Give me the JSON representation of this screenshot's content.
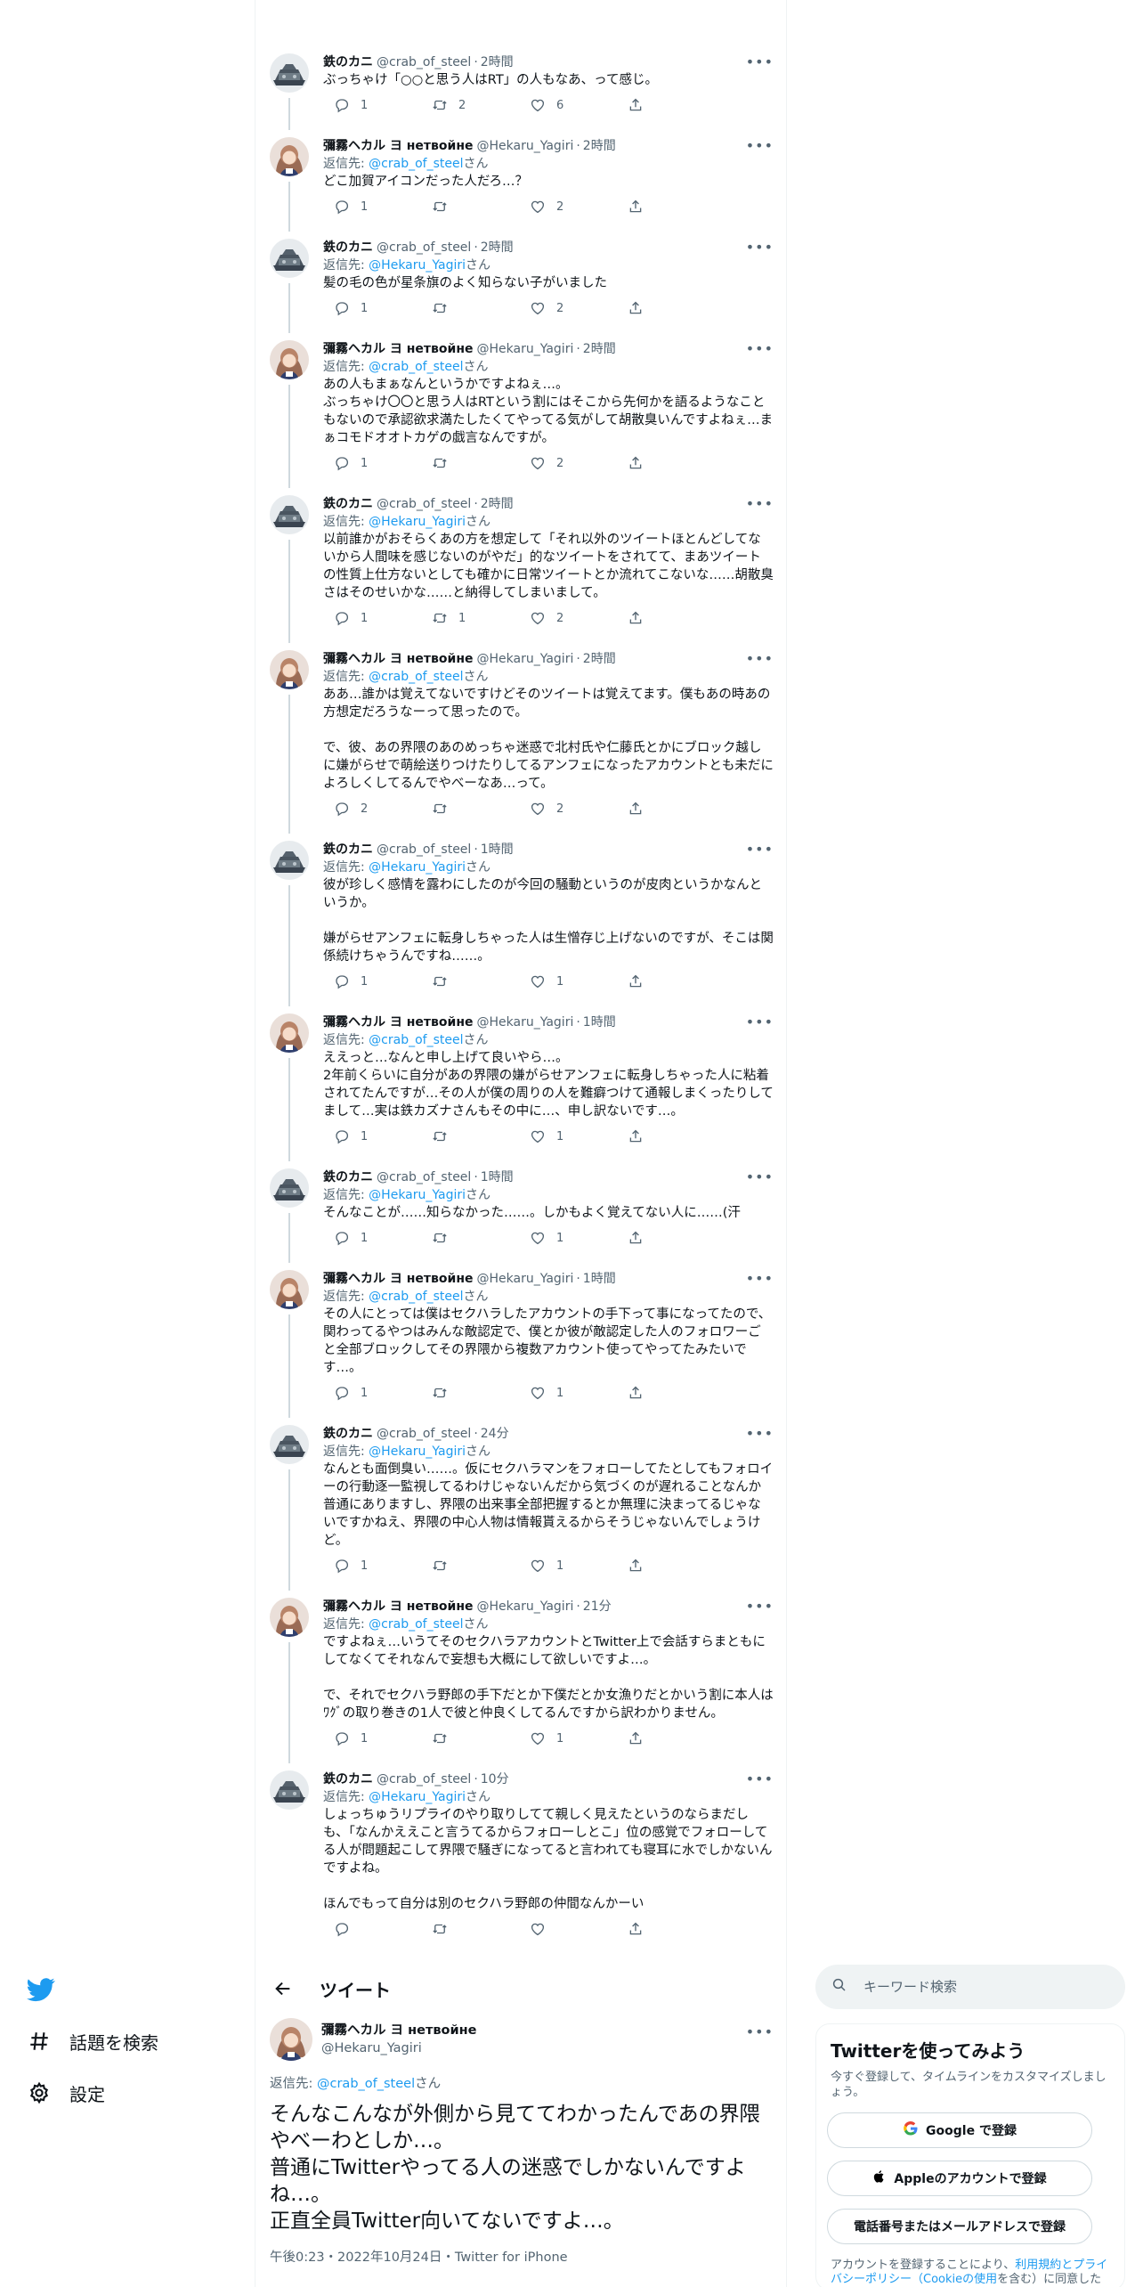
{
  "nav": {
    "explore_label": "話題を検索",
    "settings_label": "設定"
  },
  "colors": {
    "accent": "#1d9bf0",
    "muted": "#536471",
    "text": "#0f1419",
    "border": "#eff3f4"
  },
  "reply_prefix": "返信先: ",
  "reply_suffix": "さん",
  "tweets": [
    {
      "author": "crab",
      "name": "鉄のカニ",
      "handle": "@crab_of_steel",
      "time": "2時間",
      "reply_to": "",
      "text": "ぶっちゃけ「○○と思う人はRT」の人もなあ、って感じ。",
      "replies": "1",
      "retweets": "2",
      "likes": "6"
    },
    {
      "author": "hekaru",
      "name": "彌霧ヘカル ヨ нетвойне",
      "handle": "@Hekaru_Yagiri",
      "time": "2時間",
      "reply_to": "@crab_of_steel",
      "text": "どこ加賀アイコンだった人だろ…？",
      "replies": "1",
      "retweets": "",
      "likes": "2"
    },
    {
      "author": "crab",
      "name": "鉄のカニ",
      "handle": "@crab_of_steel",
      "time": "2時間",
      "reply_to": "@Hekaru_Yagiri",
      "text": "髪の毛の色が星条旗のよく知らない子がいました",
      "replies": "1",
      "retweets": "",
      "likes": "2"
    },
    {
      "author": "hekaru",
      "name": "彌霧ヘカル ヨ нетвойне",
      "handle": "@Hekaru_Yagiri",
      "time": "2時間",
      "reply_to": "@crab_of_steel",
      "text": "あの人もまぁなんというかですよねぇ…。\nぶっちゃけ〇〇と思う人はRTという割にはそこから先何かを語るようなこともないので承認欲求満たしたくてやってる気がして胡散臭いんですよねぇ…まぁコモドオオトカゲの戯言なんですが。",
      "replies": "1",
      "retweets": "",
      "likes": "2"
    },
    {
      "author": "crab",
      "name": "鉄のカニ",
      "handle": "@crab_of_steel",
      "time": "2時間",
      "reply_to": "@Hekaru_Yagiri",
      "text": "以前誰かがおそらくあの方を想定して「それ以外のツイートほとんどしてないから人間味を感じないのがやだ」的なツイートをされてて、まあツイートの性質上仕方ないとしても確かに日常ツイートとか流れてこないな……胡散臭さはそのせいかな……と納得してしまいまして。",
      "replies": "1",
      "retweets": "1",
      "likes": "2"
    },
    {
      "author": "hekaru",
      "name": "彌霧ヘカル ヨ нетвойне",
      "handle": "@Hekaru_Yagiri",
      "time": "2時間",
      "reply_to": "@crab_of_steel",
      "text": "ああ…誰かは覚えてないですけどそのツイートは覚えてます。僕もあの時あの方想定だろうなーって思ったので。\n\nで、彼、あの界隈のあのめっちゃ迷惑で北村氏や仁藤氏とかにブロック越しに嫌がらせで萌絵送りつけたりしてるアンフェになったアカウントとも未だによろしくしてるんでやべーなあ…って。",
      "replies": "2",
      "retweets": "",
      "likes": "2"
    },
    {
      "author": "crab",
      "name": "鉄のカニ",
      "handle": "@crab_of_steel",
      "time": "1時間",
      "reply_to": "@Hekaru_Yagiri",
      "text": "彼が珍しく感情を露わにしたのが今回の騒動というのが皮肉というかなんというか。\n\n嫌がらせアンフェに転身しちゃった人は生憎存じ上げないのですが、そこは関係続けちゃうんですね……。",
      "replies": "1",
      "retweets": "",
      "likes": "1"
    },
    {
      "author": "hekaru",
      "name": "彌霧ヘカル ヨ нетвойне",
      "handle": "@Hekaru_Yagiri",
      "time": "1時間",
      "reply_to": "@crab_of_steel",
      "text": "ええっと…なんと申し上げて良いやら…。\n2年前くらいに自分があの界隈の嫌がらせアンフェに転身しちゃった人に粘着されてたんですが…その人が僕の周りの人を難癖つけて通報しまくったりしてまして…実は鉄カズナさんもその中に…、申し訳ないです…。",
      "replies": "1",
      "retweets": "",
      "likes": "1"
    },
    {
      "author": "crab",
      "name": "鉄のカニ",
      "handle": "@crab_of_steel",
      "time": "1時間",
      "reply_to": "@Hekaru_Yagiri",
      "text": "そんなことが……知らなかった……。しかもよく覚えてない人に……(汗",
      "replies": "1",
      "retweets": "",
      "likes": "1"
    },
    {
      "author": "hekaru",
      "name": "彌霧ヘカル ヨ нетвойне",
      "handle": "@Hekaru_Yagiri",
      "time": "1時間",
      "reply_to": "@crab_of_steel",
      "text": "その人にとっては僕はセクハラしたアカウントの手下って事になってたので、関わってるやつはみんな敵認定で、僕とか彼が敵認定した人のフォロワーごと全部ブロックしてその界隈から複数アカウント使ってやってたみたいです…。",
      "replies": "1",
      "retweets": "",
      "likes": "1"
    },
    {
      "author": "crab",
      "name": "鉄のカニ",
      "handle": "@crab_of_steel",
      "time": "24分",
      "reply_to": "@Hekaru_Yagiri",
      "text": "なんとも面倒臭い……。仮にセクハラマンをフォローしてたとしてもフォロイーの行動逐一監視してるわけじゃないんだから気づくのが遅れることなんか普通にありますし、界隈の出来事全部把握するとか無理に決まってるじゃないですかねえ、界隈の中心人物は情報貰えるからそうじゃないんでしょうけど。",
      "replies": "1",
      "retweets": "",
      "likes": "1"
    },
    {
      "author": "hekaru",
      "name": "彌霧ヘカル ヨ нетвойне",
      "handle": "@Hekaru_Yagiri",
      "time": "21分",
      "reply_to": "@crab_of_steel",
      "text": "ですよねぇ…いうてそのセクハラアカウントとTwitter上で会話すらまともにしてなくてそれなんで妄想も大概にして欲しいですよ…。\n\nで、それでセクハラ野郎の手下だとか下僕だとか女漁りだとかいう割に本人はﾜｸﾞの取り巻きの1人で彼と仲良くしてるんですから訳わかりません。",
      "replies": "1",
      "retweets": "",
      "likes": "1"
    },
    {
      "author": "crab",
      "name": "鉄のカニ",
      "handle": "@crab_of_steel",
      "time": "10分",
      "reply_to": "@Hekaru_Yagiri",
      "text": "しょっちゅうリプライのやり取りしてて親しく見えたというのならまだしも、「なんかええこと言うてるからフォローしとこ」位の感覚でフォローしてる人が問題起こして界隈で騒ぎになってると言われても寝耳に水でしかないんですよね。\n\nほんでもって自分は別のセクハラ野郎の仲間なんかーい",
      "replies": "",
      "retweets": "",
      "likes": ""
    }
  ],
  "main_tweet": {
    "header_title": "ツイート",
    "name": "彌霧ヘカル ヨ нетвойне",
    "handle": "@Hekaru_Yagiri",
    "reply_to": "@crab_of_steel",
    "text": "そんなこんなが外側から見ててわかったんであの界隈やべーわとしか…。\n普通にTwitterやってる人の迷惑でしかないんですよね…。\n正直全員Twitter向いてないですよ…。",
    "meta": "午後0:23・2022年10月24日・Twitter for iPhone"
  },
  "search": {
    "placeholder": "キーワード検索"
  },
  "signup": {
    "title": "Twitterを使ってみよう",
    "desc": "今すぐ登録して、タイムラインをカスタマイズしましょう。",
    "google_label": "Google で登録",
    "apple_label": "Appleのアカウントで登録",
    "phone_label": "電話番号またはメールアドレスで登録",
    "legal_prefix": "アカウントを登録することにより、",
    "legal_link": "利用規約とプライバシーポリシー（Cookieの使用",
    "legal_suffix": "を含む）に同意したとみなされます。"
  }
}
